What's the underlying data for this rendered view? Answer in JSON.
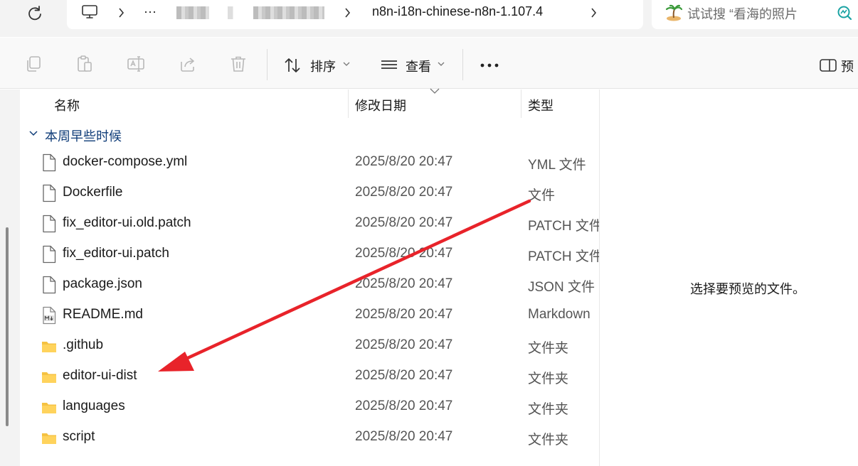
{
  "breadcrumb": {
    "ellipsis": "···",
    "current_folder": "n8n-i18n-chinese-n8n-1.107.4"
  },
  "search": {
    "placeholder": "试试搜 “看海的照片"
  },
  "toolbar": {
    "sort_label": "排序",
    "view_label": "查看",
    "preview_label": "预"
  },
  "columns": {
    "name": "名称",
    "modified": "修改日期",
    "type": "类型"
  },
  "group": {
    "label": "本周早些时候"
  },
  "files": [
    {
      "name": "docker-compose.yml",
      "date": "2025/8/20 20:47",
      "type": "YML 文件",
      "icon": "file-icon"
    },
    {
      "name": "Dockerfile",
      "date": "2025/8/20 20:47",
      "type": "文件",
      "icon": "file-icon"
    },
    {
      "name": "fix_editor-ui.old.patch",
      "date": "2025/8/20 20:47",
      "type": "PATCH 文件",
      "icon": "file-icon"
    },
    {
      "name": "fix_editor-ui.patch",
      "date": "2025/8/20 20:47",
      "type": "PATCH 文件",
      "icon": "file-icon"
    },
    {
      "name": "package.json",
      "date": "2025/8/20 20:47",
      "type": "JSON 文件",
      "icon": "file-icon"
    },
    {
      "name": "README.md",
      "date": "2025/8/20 20:47",
      "type": "Markdown",
      "icon": "markdown-file-icon"
    },
    {
      "name": ".github",
      "date": "2025/8/20 20:47",
      "type": "文件夹",
      "icon": "folder-icon"
    },
    {
      "name": "editor-ui-dist",
      "date": "2025/8/20 20:47",
      "type": "文件夹",
      "icon": "folder-icon"
    },
    {
      "name": "languages",
      "date": "2025/8/20 20:47",
      "type": "文件夹",
      "icon": "folder-icon"
    },
    {
      "name": "script",
      "date": "2025/8/20 20:47",
      "type": "文件夹",
      "icon": "folder-icon"
    }
  ],
  "preview": {
    "message": "选择要预览的文件。"
  },
  "colors": {
    "annotation_arrow": "#e8232a",
    "folder": "#f5c242",
    "group_text": "#0f3c78"
  }
}
